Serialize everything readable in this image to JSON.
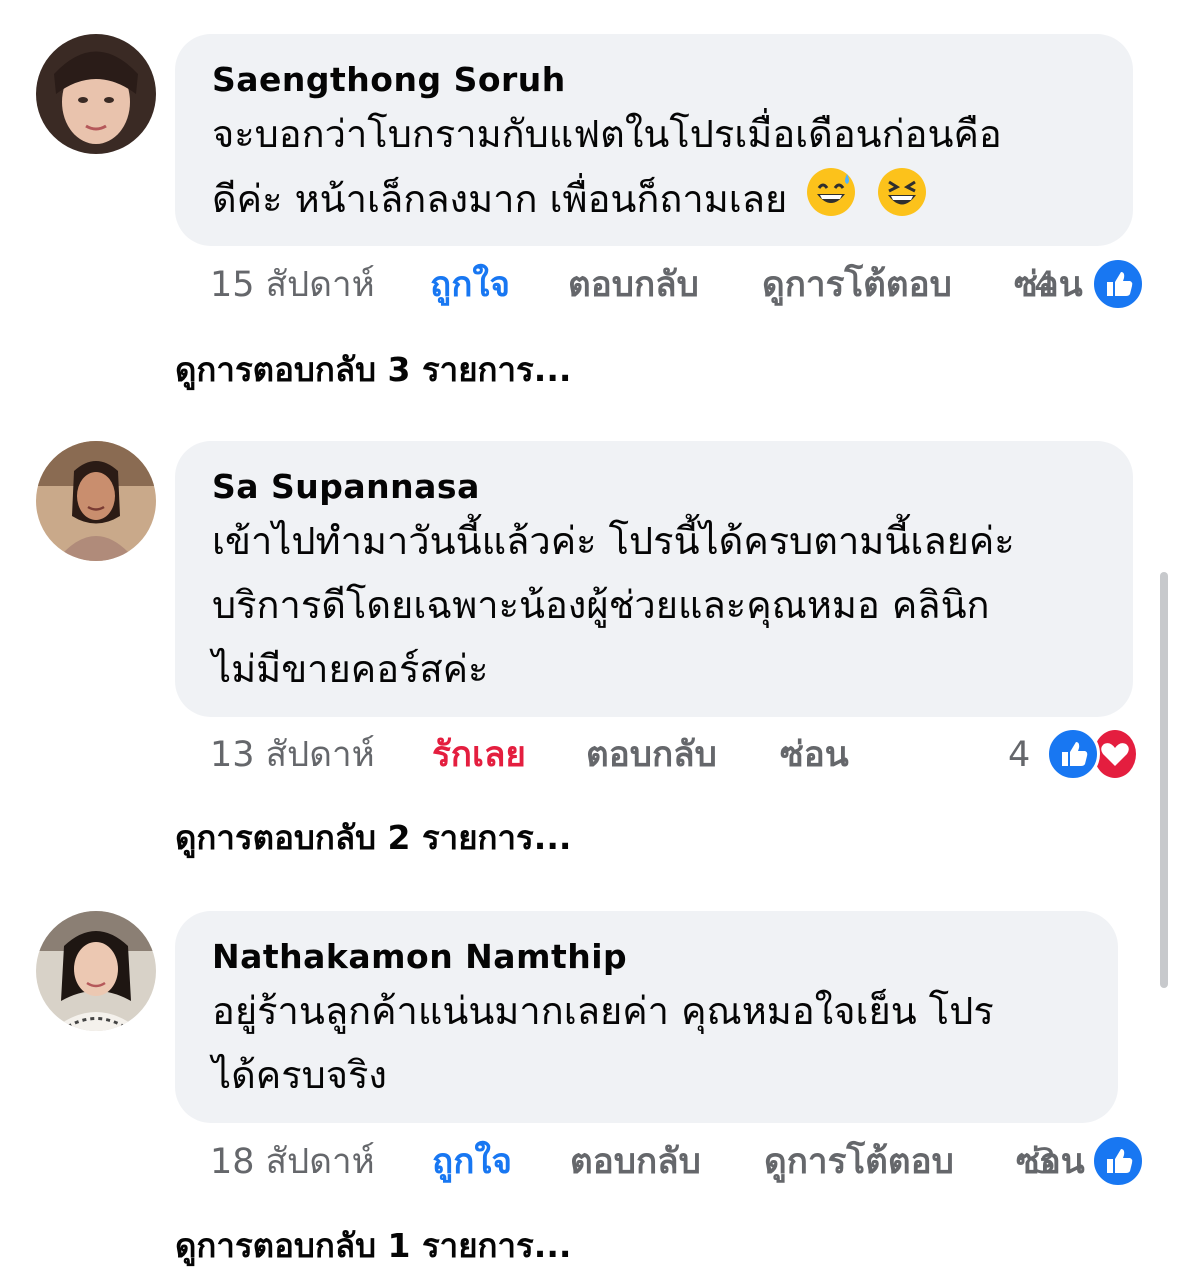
{
  "comments": [
    {
      "author": "Saengthong Soruh",
      "text_line1": "จะบอกว่าโบกรามกับแฟตในโปรเมื่อเดือนก่อนคือ",
      "text_line2": "ดีค่ะ หน้าเล็กลงมาก เพื่อนก็ถามเลย",
      "emojis": [
        "grinning-sweat-emoji",
        "laughing-emoji"
      ],
      "time": "15 สัปดาห์",
      "reaction_label": "ถูกใจ",
      "reply_label": "ตอบกลับ",
      "interaction_label": "ดูการโต้ตอบ",
      "hide_label": "ซ่อน",
      "reaction_count": "4",
      "view_replies": "ดูการตอบกลับ 3 รายการ..."
    },
    {
      "author": "Sa Supannasa",
      "text_line1": "เข้าไปทำมาวันนี้แล้วค่ะ โปรนี้ได้ครบตามนี้เลยค่ะ",
      "text_line2": "บริการดีโดยเฉพาะน้องผู้ช่วยและคุณหมอ คลินิก",
      "text_line3": "ไม่มีขายคอร์สค่ะ",
      "time": "13 สัปดาห์",
      "reaction_label": "รักเลย",
      "reply_label": "ตอบกลับ",
      "hide_label": "ซ่อน",
      "reaction_count": "4",
      "view_replies": "ดูการตอบกลับ 2 รายการ..."
    },
    {
      "author": "Nathakamon Namthip",
      "text_line1": "อยู่ร้านลูกค้าแน่นมากเลยค่า คุณหมอใจเย็น โปร",
      "text_line2": "ได้ครบจริง",
      "time": "18 สัปดาห์",
      "reaction_label": "ถูกใจ",
      "reply_label": "ตอบกลับ",
      "interaction_label": "ดูการโต้ตอบ",
      "hide_label": "ซ่อน",
      "reaction_count": "3",
      "view_replies": "ดูการตอบกลับ 1 รายการ..."
    }
  ],
  "colors": {
    "bubble": "#f0f2f5",
    "like_blue": "#1877f2",
    "love_red": "#e41e3f",
    "meta_gray": "#65676b"
  }
}
